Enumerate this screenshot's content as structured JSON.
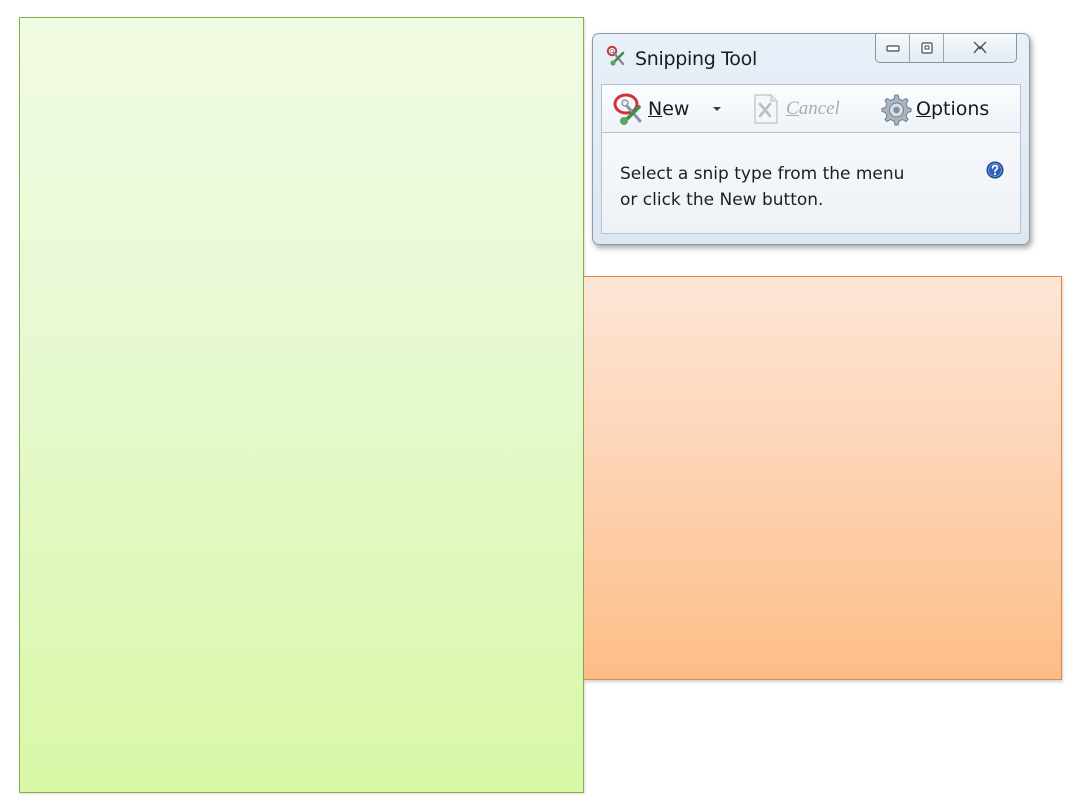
{
  "window": {
    "title": "Snipping Tool",
    "minimize_icon": "minimize-icon",
    "maximize_icon": "maximize-icon",
    "close_icon": "close-icon"
  },
  "toolbar": {
    "new_label_underlined": "N",
    "new_label_rest": "ew",
    "cancel_label_underlined": "C",
    "cancel_label_rest": "ancel",
    "options_label_underlined": "O",
    "options_label_rest": "ptions"
  },
  "message": {
    "line1": "Select a snip type from the menu",
    "line2": "or click the New button."
  },
  "colors": {
    "green_panel": "#e8f9d3",
    "orange_panel": "#fdd2b2",
    "window_frame": "#dce7f3"
  }
}
